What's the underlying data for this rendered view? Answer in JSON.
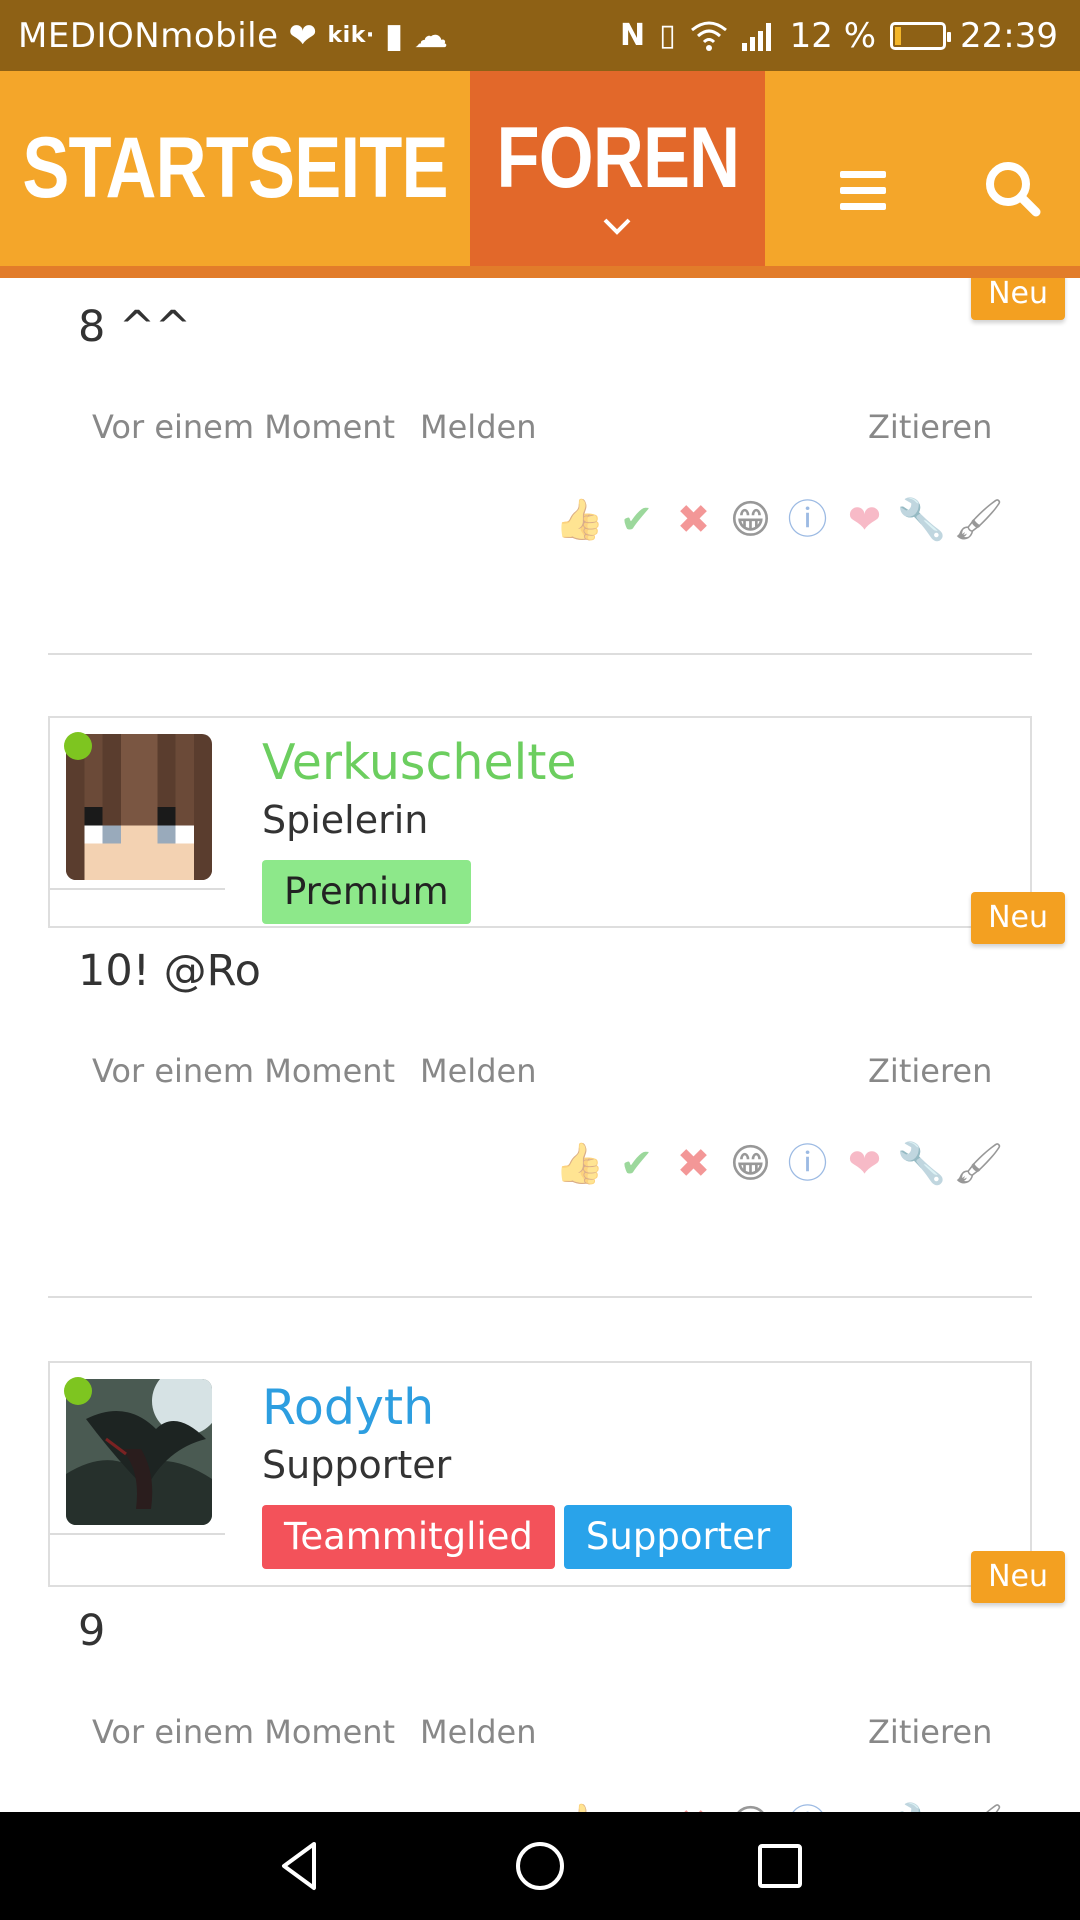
{
  "status_bar": {
    "carrier": "MEDIONmobile",
    "app_label": "kik·",
    "signal_text": "12 %",
    "battery_percent": 12,
    "time": "22:39"
  },
  "navbar": {
    "home_label": "STARTSEITE",
    "forums_label": "FOREN",
    "colors": {
      "bar": "#f4a62a",
      "active": "#e2682a",
      "underline": "#d2481f"
    }
  },
  "posts": [
    {
      "message": "8 ^^",
      "time": "Vor einem Moment",
      "report": "Melden",
      "quote": "Zitieren",
      "new_badge": "Neu"
    },
    {
      "username": "Verkuschelte",
      "username_color": "#6cce5f",
      "role": "Spielerin",
      "badges": [
        {
          "label": "Premium",
          "bg": "#8de88a",
          "fg": "#222222"
        }
      ],
      "new_badge": "Neu",
      "message": "10! @Ro",
      "time": "Vor einem Moment",
      "report": "Melden",
      "quote": "Zitieren",
      "online": true
    },
    {
      "username": "Rodyth",
      "username_color": "#2d9ee0",
      "role": "Supporter",
      "badges": [
        {
          "label": "Teammitglied",
          "bg": "#f3525a",
          "fg": "#ffffff"
        },
        {
          "label": "Supporter",
          "bg": "#29a3ea",
          "fg": "#ffffff"
        }
      ],
      "new_badge": "Neu",
      "message": "9",
      "time": "Vor einem Moment",
      "report": "Melden",
      "quote": "Zitieren",
      "online": true
    }
  ],
  "reaction_icons": [
    "thumbs-up-icon",
    "checkmark-icon",
    "cross-icon",
    "grin-icon",
    "info-icon",
    "heart-icon",
    "wrench-icon",
    "brush-icon"
  ]
}
